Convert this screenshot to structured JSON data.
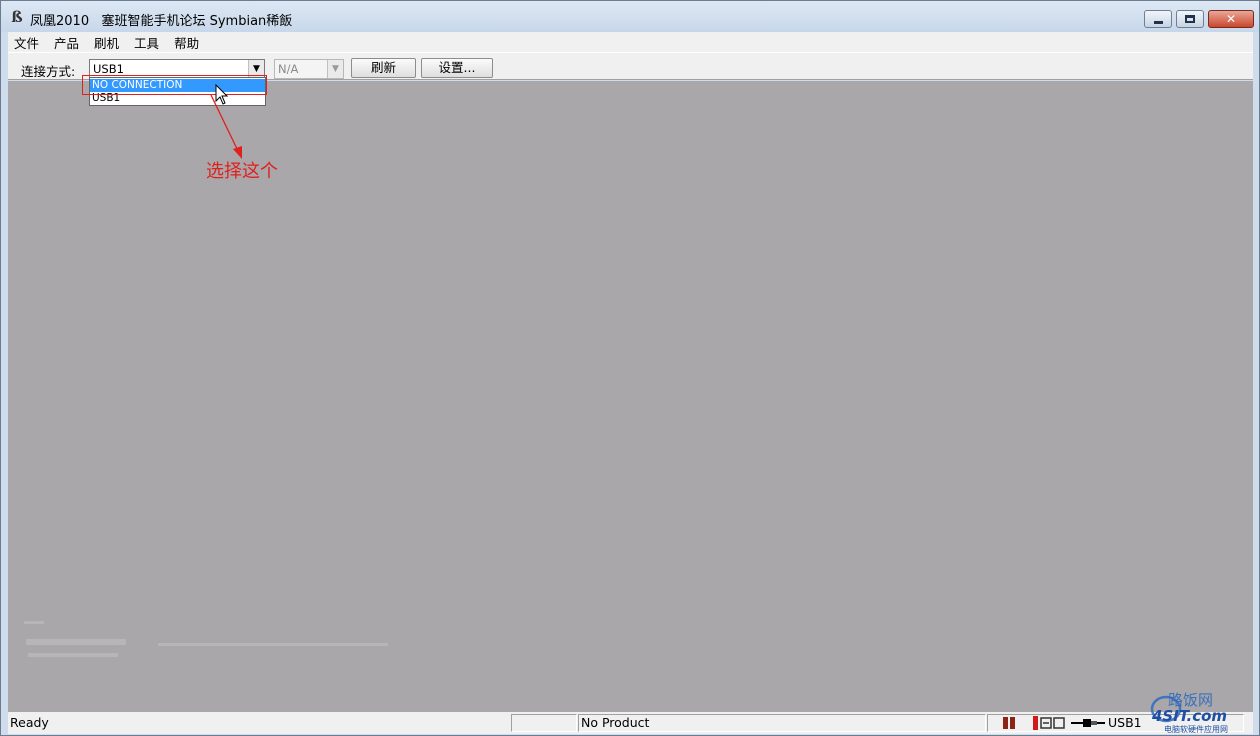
{
  "window": {
    "title": "凤凰2010   塞班智能手机论坛 Symbian稀飯"
  },
  "menu": {
    "items": [
      "文件",
      "产品",
      "刷机",
      "工具",
      "帮助"
    ]
  },
  "toolbar": {
    "connection_label": "连接方式:",
    "connection_value": "USB1",
    "product_value": "N/A",
    "refresh_label": "刷新",
    "settings_label": "设置..."
  },
  "dropdown": {
    "options": [
      "NO CONNECTION",
      "USB1"
    ],
    "selected": "NO CONNECTION"
  },
  "annotation": {
    "text": "选择这个",
    "color": "#e0201e"
  },
  "statusbar": {
    "ready": "Ready",
    "product": "No Product",
    "connection": "USB1"
  },
  "watermark": {
    "main": "4SIT.com",
    "cn_title": "路饭网",
    "cn_sub": "电脑软硬件应用网"
  },
  "colors": {
    "selection": "#3399ff",
    "main_area": "#a9a7aa",
    "annotation": "#e0201e"
  }
}
